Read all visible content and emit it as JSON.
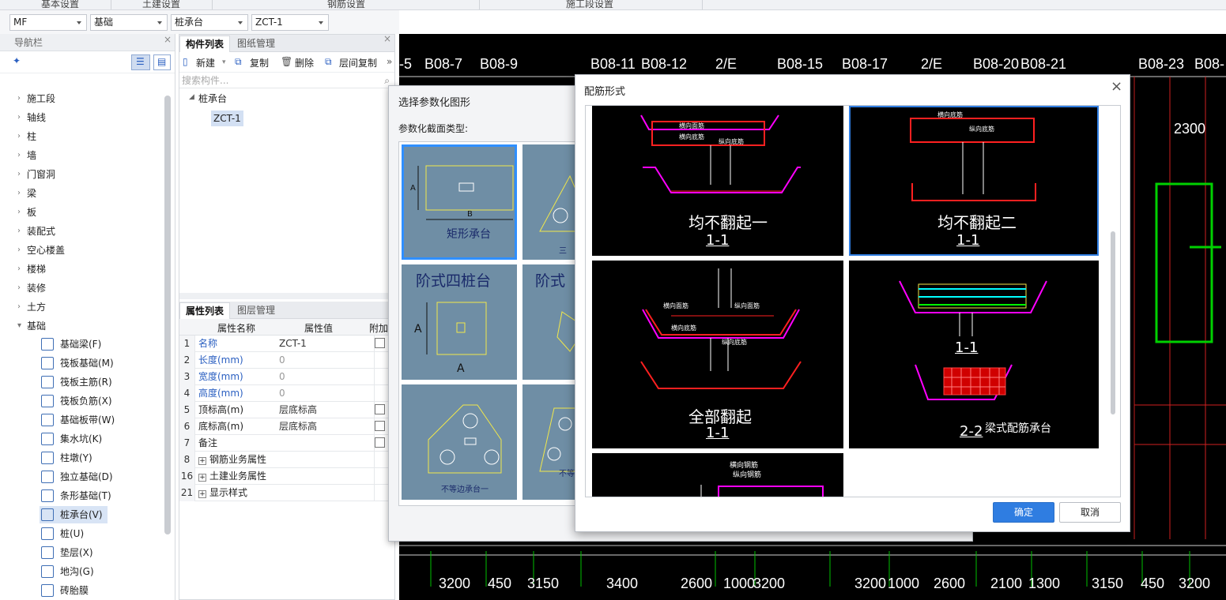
{
  "topbar": {
    "t1": "基本设置",
    "t2": "土建设置",
    "t3": "钢筋设置",
    "t4": "施工段设置"
  },
  "selects": [
    "MF",
    "基础",
    "桩承台",
    "ZCT-1"
  ],
  "nav": {
    "title": "导航栏",
    "items": [
      "施工段",
      "轴线",
      "柱",
      "墙",
      "门窗洞",
      "梁",
      "板",
      "装配式",
      "空心楼盖",
      "楼梯",
      "装修",
      "土方",
      "基础"
    ],
    "sub": [
      "基础梁(F)",
      "筏板基础(M)",
      "筏板主筋(R)",
      "筏板负筋(X)",
      "基础板带(W)",
      "集水坑(K)",
      "柱墩(Y)",
      "独立基础(D)",
      "条形基础(T)",
      "桩承台(V)",
      "桩(U)",
      "垫层(X)",
      "地沟(G)",
      "砖胎膜"
    ]
  },
  "comp": {
    "tab1": "构件列表",
    "tab2": "图纸管理",
    "new": "新建",
    "copy": "复制",
    "del": "删除",
    "floorcopy": "层间复制",
    "search": "搜索构件...",
    "tree_root": "桩承台",
    "tree_child": "ZCT-1"
  },
  "props": {
    "tab1": "属性列表",
    "tab2": "图层管理",
    "h_name": "属性名称",
    "h_val": "属性值",
    "h_add": "附加",
    "rows": [
      {
        "n": "1",
        "k": "名称",
        "v": "ZCT-1",
        "blue": true,
        "chk": true
      },
      {
        "n": "2",
        "k": "长度(mm)",
        "v": "0",
        "blue": true,
        "chk": false
      },
      {
        "n": "3",
        "k": "宽度(mm)",
        "v": "0",
        "blue": true,
        "chk": false
      },
      {
        "n": "4",
        "k": "高度(mm)",
        "v": "0",
        "blue": true,
        "chk": false
      },
      {
        "n": "5",
        "k": "顶标高(m)",
        "v": "层底标高",
        "blue": false,
        "chk": true
      },
      {
        "n": "6",
        "k": "底标高(m)",
        "v": "层底标高",
        "blue": false,
        "chk": true
      },
      {
        "n": "7",
        "k": "备注",
        "v": "",
        "blue": false,
        "chk": true
      },
      {
        "n": "8",
        "k": "钢筋业务属性",
        "v": "",
        "blue": false,
        "chk": false,
        "exp": true
      },
      {
        "n": "16",
        "k": "土建业务属性",
        "v": "",
        "blue": false,
        "chk": false,
        "exp": true
      },
      {
        "n": "21",
        "k": "显示样式",
        "v": "",
        "blue": false,
        "chk": false,
        "exp": true
      }
    ]
  },
  "cad": {
    "top_labels": [
      "-5",
      "B08-7",
      "B08-9",
      "B08-11",
      "B08-12",
      "2/E",
      "B08-15",
      "B08-17",
      "2/E",
      "B08-20",
      "B08-21",
      "B08-23",
      "B08-"
    ],
    "bottom_dims": [
      "3200",
      "450",
      "3150",
      "3400",
      "2600",
      "1000",
      "3200",
      "3200",
      "1000",
      "2600",
      "2100",
      "1300",
      "3150",
      "450",
      "3200"
    ],
    "dim_2300": "2300"
  },
  "dlg1": {
    "title": "选择参数化图形",
    "label": "参数化截面类型:",
    "cap1": "矩形承台",
    "cap2": "阶式四桩台",
    "cap3": "阶式",
    "cap4": "不等边承台一",
    "cap_tri": "三",
    "cap_ne": "不等"
  },
  "dlg2": {
    "title": "配筋形式",
    "c1": "均不翻起一",
    "c2": "均不翻起二",
    "c3": "全部翻起",
    "c4": "梁式配筋承台",
    "sec": "1-1",
    "sec2": "2-2",
    "ok": "确定",
    "cancel": "取消",
    "lbls": {
      "hx": "横向面筋",
      "zx": "纵向面筋",
      "hd": "横向底筋",
      "zd": "纵向底筋",
      "hg": "横向钢筋",
      "zg": "纵向钢筋"
    }
  },
  "colors": {
    "accent": "#2f7de1",
    "panel": "#6f8ea5",
    "cadgreen": "#00c000",
    "red": "#ff2020",
    "magenta": "#ff00ff"
  }
}
